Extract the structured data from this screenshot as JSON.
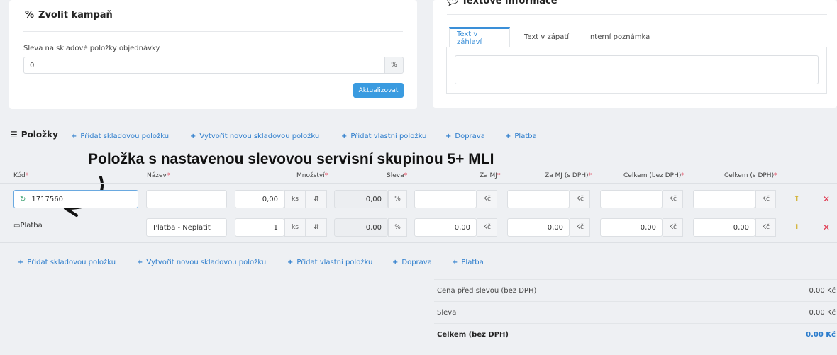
{
  "campaign": {
    "title": "Zvolit kampaň",
    "title_icon": "%",
    "discount_label": "Sleva na skladové položky objednávky",
    "discount_value": "0",
    "discount_unit": "%",
    "update_button": "Aktualizovat"
  },
  "text_info": {
    "title": "Textové informace",
    "tabs": [
      "Text v záhlaví",
      "Text v zápatí",
      "Interní poznámka"
    ]
  },
  "items": {
    "title": "Položky",
    "actions_top": [
      "Přidat skladovou položku",
      "Vytvořit novou skladovou položku",
      "Přidat vlastní položku",
      "Doprava",
      "Platba"
    ],
    "actions_bottom": [
      "Přidat skladovou položku",
      "Vytvořit novou skladovou položku",
      "Přidat vlastní položku",
      "Doprava",
      "Platba"
    ],
    "annotation": "Položka s nastavenou slevovou servisní skupinou 5+ MLI",
    "columns": {
      "code": "Kód",
      "name": "Název",
      "qty": "Množství",
      "discount": "Sleva",
      "per_unit": "Za MJ",
      "per_unit_vat": "Za MJ (s DPH)",
      "total_novat": "Celkem (bez DPH)",
      "total_vat": "Celkem (s DPH)"
    },
    "required_mark": "*",
    "rows": [
      {
        "code": "1717560",
        "name": "",
        "qty": "0,00",
        "qty_unit": "ks",
        "discount": "0,00",
        "discount_unit": "%",
        "per_unit": "",
        "per_unit_vat": "",
        "total_novat": "",
        "total_vat": "",
        "currency": "Kč"
      },
      {
        "code": "Platba",
        "name": "Platba - Neplatit",
        "qty": "1",
        "qty_unit": "ks",
        "discount": "0,00",
        "discount_unit": "%",
        "per_unit": "0,00",
        "per_unit_vat": "0,00",
        "total_novat": "0,00",
        "total_vat": "0,00",
        "currency": "Kč"
      }
    ]
  },
  "summary": [
    {
      "label": "Cena před slevou (bez DPH)",
      "value": "0.00 Kč"
    },
    {
      "label": "Sleva",
      "value": "0.00 Kč"
    },
    {
      "label": "Celkem (bez DPH)",
      "value": "0.00 Kč"
    }
  ],
  "colors": {
    "accent": "#3a9be0",
    "link": "#2b7ccc",
    "required": "#e0354c"
  }
}
